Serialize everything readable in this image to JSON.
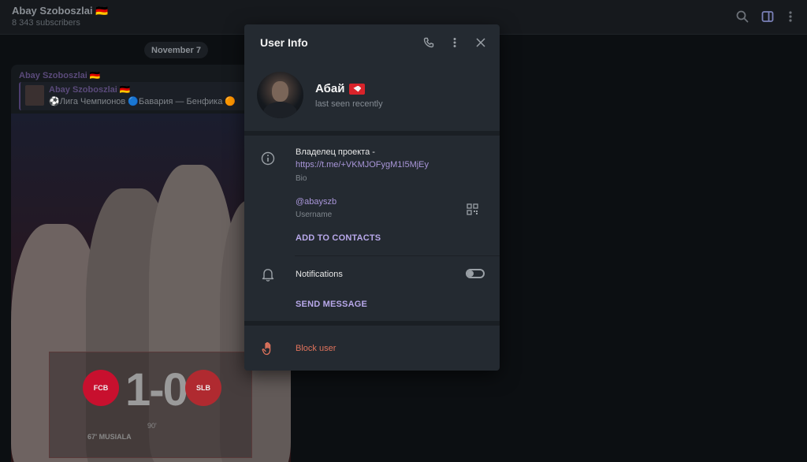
{
  "channel": {
    "title": "Abay Szoboszlai 🇩🇪",
    "subscribers": "8 343 subscribers"
  },
  "chat": {
    "date": "November 7",
    "message": {
      "author": "Abay Szoboszlai 🇩🇪",
      "reply_author": "Abay Szoboszlai 🇩🇪",
      "reply_text": "⚽Лига Чемпионов 🔵Бавария — Бенфика 🟠",
      "photo": {
        "score": "1-0",
        "minute": "90'",
        "scorer": "67' MUSIALA",
        "home_badge": "FCB",
        "away_badge": "SLB"
      }
    }
  },
  "modal": {
    "title": "User Info",
    "user": {
      "name": "Абай",
      "status": "last seen recently"
    },
    "bio": {
      "text": "Владелец проекта -",
      "link": "https://t.me/+VKMJOFygM1I5MjEy",
      "caption": "Bio"
    },
    "username": {
      "value": "@abayszb",
      "caption": "Username"
    },
    "add_to_contacts": "ADD TO CONTACTS",
    "notifications": {
      "label": "Notifications",
      "enabled": false
    },
    "send_message": "SEND MESSAGE",
    "block_user": "Block user"
  },
  "colors": {
    "modal_bg": "#242a31",
    "accent": "#b8a8ea",
    "link": "#a996d9",
    "danger": "#e0735c"
  }
}
